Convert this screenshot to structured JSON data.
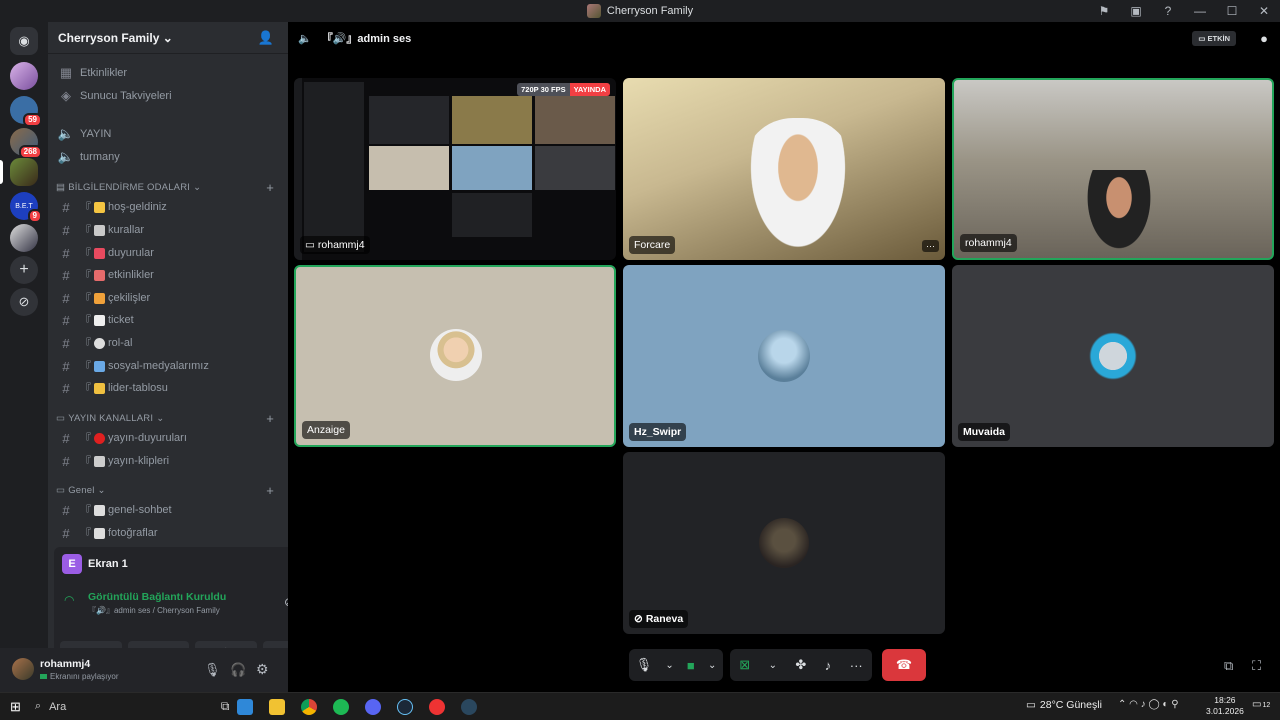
{
  "window": {
    "title": "Cherryson Family"
  },
  "rail": {
    "badges": [
      "59",
      "268",
      "9"
    ]
  },
  "guild": {
    "name": "Cherryson Family"
  },
  "nav_items": [
    {
      "label": "Etkinlikler",
      "icon": "calendar-icon"
    },
    {
      "label": "Sunucu Takviyeleri",
      "icon": "boost-icon"
    }
  ],
  "stage_channels": [
    {
      "label": "YAYIN",
      "icon": "speaker-icon"
    },
    {
      "label": "turmany",
      "icon": "speaker-icon"
    }
  ],
  "categories": {
    "info": "BİLGİLENDİRME ODALARI",
    "stream": "YAYIN KANALLARI",
    "general": "Genel"
  },
  "info_channels": [
    {
      "prefix": "『",
      "name": "hoş-geldiniz",
      "color": "#f5c542"
    },
    {
      "prefix": "『",
      "name": "kurallar",
      "color": "#c9c9c9"
    },
    {
      "prefix": "『",
      "name": "duyurular",
      "color": "#e84a5f"
    },
    {
      "prefix": "『",
      "name": "etkinlikler",
      "color": "#e66b6b"
    },
    {
      "prefix": "『",
      "name": "çekilişler",
      "color": "#f0a13a"
    },
    {
      "prefix": "『",
      "name": "ticket",
      "color": "#eee"
    },
    {
      "prefix": "『",
      "name": "rol-al",
      "color": "#ddd"
    },
    {
      "prefix": "『",
      "name": "sosyal-medyalarımız",
      "color": "#6aa9e6"
    },
    {
      "prefix": "『",
      "name": "lider-tablosu",
      "color": "#f0c040"
    }
  ],
  "stream_channels": [
    {
      "prefix": "『",
      "name": "yayın-duyuruları",
      "color": "#e02020"
    },
    {
      "prefix": "『",
      "name": "yayın-klipleri",
      "color": "#ccc"
    }
  ],
  "general_channels": [
    {
      "prefix": "『",
      "name": "genel-sohbet",
      "color": "#ddd"
    },
    {
      "prefix": "『",
      "name": "fotoğraflar",
      "color": "#ddd"
    }
  ],
  "voice_panel": {
    "screen_letter": "E",
    "screen_label": "Ekran 1",
    "status": "Görüntülü Bağlantı Kuruldu",
    "channel": "『🔊』admin ses / Cherryson Family"
  },
  "user": {
    "name": "rohammj4",
    "status": "Ekranını paylaşıyor"
  },
  "call": {
    "channel": "『🔊』admin ses",
    "active_badge": "ETKİN",
    "stream_badge_quality": "720P 30 FPS",
    "stream_badge_live": "YAYINDA"
  },
  "tiles": [
    {
      "name": "rohammj4",
      "kind": "screen"
    },
    {
      "name": "Forcare",
      "kind": "camera"
    },
    {
      "name": "rohammj4",
      "kind": "camera"
    },
    {
      "name": "Anzaige",
      "kind": "avatar"
    },
    {
      "name": "Hz_Swipr",
      "kind": "avatar"
    },
    {
      "name": "Muvaida",
      "kind": "avatar"
    },
    {
      "name": "Raneva",
      "kind": "avatar",
      "muted": true
    }
  ],
  "taskbar": {
    "search": "Ara",
    "weather": "28°C  Güneşli",
    "time": "18:26",
    "date": "3.01.2026",
    "notifications": "12"
  }
}
